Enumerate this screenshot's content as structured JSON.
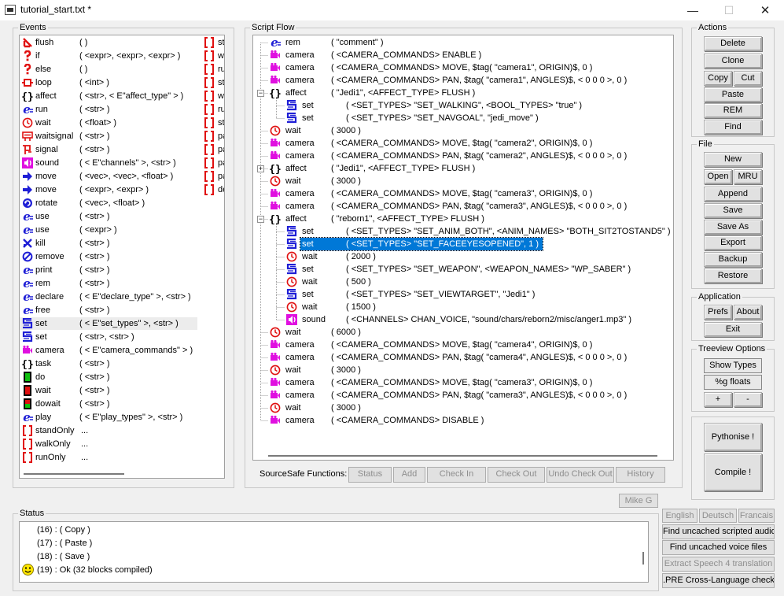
{
  "window": {
    "title": "tutorial_start.txt *",
    "minimize_glyph": "—",
    "maximize_glyph": "☐",
    "close_glyph": "✕"
  },
  "events": {
    "label": "Events",
    "items": [
      {
        "icon": "flush-icon",
        "name": "flush",
        "args": "(   )"
      },
      {
        "icon": "if-icon",
        "name": "if",
        "args": "( <expr>, <expr>, <expr> )"
      },
      {
        "icon": "else-icon",
        "name": "else",
        "args": "(   )"
      },
      {
        "icon": "loop-icon",
        "name": "loop",
        "args": "( <int> )"
      },
      {
        "icon": "affect-icon",
        "name": "affect",
        "args": "( <str>, < E\"affect_type\" > )"
      },
      {
        "icon": "run-icon",
        "name": "run",
        "args": "( <str> )"
      },
      {
        "icon": "wait-icon",
        "name": "wait",
        "args": "( <float> )"
      },
      {
        "icon": "waitsignal-icon",
        "name": "waitsignal",
        "args": "( <str> )"
      },
      {
        "icon": "signal-icon",
        "name": "signal",
        "args": "( <str> )"
      },
      {
        "icon": "sound-icon",
        "name": "sound",
        "args": "( < E\"channels\" >, <str> )"
      },
      {
        "icon": "move-icon",
        "name": "move",
        "args": "( <vec>, <vec>, <float> )"
      },
      {
        "icon": "move-icon",
        "name": "move",
        "args": "( <expr>, <expr> )"
      },
      {
        "icon": "rotate-icon",
        "name": "rotate",
        "args": "( <vec>, <float> )"
      },
      {
        "icon": "use-icon",
        "name": "use",
        "args": "( <str> )"
      },
      {
        "icon": "use-icon",
        "name": "use",
        "args": "( <expr> )"
      },
      {
        "icon": "kill-icon",
        "name": "kill",
        "args": "( <str> )"
      },
      {
        "icon": "remove-icon",
        "name": "remove",
        "args": "( <str> )"
      },
      {
        "icon": "print-icon",
        "name": "print",
        "args": "( <str> )"
      },
      {
        "icon": "rem-icon",
        "name": "rem",
        "args": "( <str> )"
      },
      {
        "icon": "declare-icon",
        "name": "declare",
        "args": "( < E\"declare_type\" >, <str> )"
      },
      {
        "icon": "free-icon",
        "name": "free",
        "args": "( <str> )"
      },
      {
        "icon": "set-icon",
        "name": "set",
        "args": "( < E\"set_types\" >, <str> )"
      },
      {
        "icon": "set-icon",
        "name": "set",
        "args": "( <str>, <str> )"
      },
      {
        "icon": "camera-icon",
        "name": "camera",
        "args": "( < E\"camera_commands\" > )"
      },
      {
        "icon": "task-icon",
        "name": "task",
        "args": "( <str> )"
      },
      {
        "icon": "do-icon",
        "name": "do",
        "args": "( <str> )"
      },
      {
        "icon": "wait-task-icon",
        "name": "wait",
        "args": "( <str> )"
      },
      {
        "icon": "dowait-icon",
        "name": "dowait",
        "args": "( <str> )"
      },
      {
        "icon": "play-icon",
        "name": "play",
        "args": "( < E\"play_types\" >, <str> )"
      },
      {
        "icon": "bracket-icon",
        "name": "standOnly",
        "args": "..."
      },
      {
        "icon": "bracket-icon",
        "name": "walkOnly",
        "args": "..."
      },
      {
        "icon": "bracket-icon",
        "name": "runOnly",
        "args": "..."
      }
    ],
    "col2": [
      "st",
      "w",
      "ru",
      "st",
      "w",
      "ru",
      "st",
      "pa",
      "pa",
      "pa",
      "pa",
      "de"
    ]
  },
  "script_flow": {
    "label": "Script Flow",
    "rows": [
      {
        "icon": "rem-icon",
        "name": "rem",
        "args": "( \"comment\" )"
      },
      {
        "icon": "camera-icon",
        "name": "camera",
        "args": "( <CAMERA_COMMANDS> ENABLE )"
      },
      {
        "icon": "camera-icon",
        "name": "camera",
        "args": "( <CAMERA_COMMANDS> MOVE, $tag( \"camera1\", ORIGIN)$, 0 )"
      },
      {
        "icon": "camera-icon",
        "name": "camera",
        "args": "( <CAMERA_COMMANDS> PAN, $tag( \"camera1\", ANGLES)$, < 0 0 0 >, 0 )"
      },
      {
        "icon": "affect-icon",
        "name": "affect",
        "args": "( \"Jedi1\", <AFFECT_TYPE> FLUSH )"
      },
      {
        "icon": "set-icon",
        "name": "set",
        "args": "( <SET_TYPES> \"SET_WALKING\", <BOOL_TYPES> \"true\" )"
      },
      {
        "icon": "set-icon",
        "name": "set",
        "args": "( <SET_TYPES> \"SET_NAVGOAL\", \"jedi_move\" )"
      },
      {
        "icon": "wait-icon",
        "name": "wait",
        "args": "( 3000 )"
      },
      {
        "icon": "camera-icon",
        "name": "camera",
        "args": "( <CAMERA_COMMANDS> MOVE, $tag( \"camera2\", ORIGIN)$, 0 )"
      },
      {
        "icon": "camera-icon",
        "name": "camera",
        "args": "( <CAMERA_COMMANDS> PAN, $tag( \"camera2\", ANGLES)$, < 0 0 0 >, 0 )"
      },
      {
        "icon": "affect-icon",
        "name": "affect",
        "args": "( \"Jedi1\", <AFFECT_TYPE> FLUSH )"
      },
      {
        "icon": "wait-icon",
        "name": "wait",
        "args": "( 3000 )"
      },
      {
        "icon": "camera-icon",
        "name": "camera",
        "args": "( <CAMERA_COMMANDS> MOVE, $tag( \"camera3\", ORIGIN)$, 0 )"
      },
      {
        "icon": "camera-icon",
        "name": "camera",
        "args": "( <CAMERA_COMMANDS> PAN, $tag( \"camera3\", ANGLES)$, < 0 0 0 >, 0 )"
      },
      {
        "icon": "affect-icon",
        "name": "affect",
        "args": "( \"reborn1\", <AFFECT_TYPE> FLUSH )"
      },
      {
        "icon": "set-icon",
        "name": "set",
        "args": "( <SET_TYPES> \"SET_ANIM_BOTH\", <ANIM_NAMES> \"BOTH_SIT2TOSTAND5\" )"
      },
      {
        "icon": "set-icon",
        "name": "set",
        "args": "( <SET_TYPES> \"SET_FACEEYESOPENED\", 1 )"
      },
      {
        "icon": "wait-icon",
        "name": "wait",
        "args": "( 2000 )"
      },
      {
        "icon": "set-icon",
        "name": "set",
        "args": "( <SET_TYPES> \"SET_WEAPON\", <WEAPON_NAMES> \"WP_SABER\" )"
      },
      {
        "icon": "wait-icon",
        "name": "wait",
        "args": "( 500 )"
      },
      {
        "icon": "set-icon",
        "name": "set",
        "args": "( <SET_TYPES> \"SET_VIEWTARGET\", \"Jedi1\" )"
      },
      {
        "icon": "wait-icon",
        "name": "wait",
        "args": "( 1500 )"
      },
      {
        "icon": "sound-icon",
        "name": "sound",
        "args": "( <CHANNELS> CHAN_VOICE, \"sound/chars/reborn2/misc/anger1.mp3\" )"
      },
      {
        "icon": "wait-icon",
        "name": "wait",
        "args": "( 6000 )"
      },
      {
        "icon": "camera-icon",
        "name": "camera",
        "args": "( <CAMERA_COMMANDS> MOVE, $tag( \"camera4\", ORIGIN)$, 0 )"
      },
      {
        "icon": "camera-icon",
        "name": "camera",
        "args": "( <CAMERA_COMMANDS> PAN, $tag( \"camera4\", ANGLES)$, < 0 0 0 >, 0 )"
      },
      {
        "icon": "wait-icon",
        "name": "wait",
        "args": "( 3000 )"
      },
      {
        "icon": "camera-icon",
        "name": "camera",
        "args": "( <CAMERA_COMMANDS> MOVE, $tag( \"camera3\", ORIGIN)$, 0 )"
      },
      {
        "icon": "camera-icon",
        "name": "camera",
        "args": "( <CAMERA_COMMANDS> PAN, $tag( \"camera3\", ANGLES)$, < 0 0 0 >, 0 )"
      },
      {
        "icon": "wait-icon",
        "name": "wait",
        "args": "( 3000 )"
      },
      {
        "icon": "camera-icon",
        "name": "camera",
        "args": "( <CAMERA_COMMANDS> DISABLE )"
      }
    ],
    "selected_row": 16,
    "sourcesafe": {
      "label": "SourceSafe Functions:",
      "status": "Status",
      "add": "Add",
      "check_in": "Check In",
      "check_out": "Check Out",
      "undo_check_out": "Undo Check Out",
      "history": "History"
    }
  },
  "actions": {
    "label": "Actions",
    "delete": "Delete",
    "clone": "Clone",
    "copy": "Copy",
    "cut": "Cut",
    "paste": "Paste",
    "rem": "REM",
    "find": "Find"
  },
  "file": {
    "label": "File",
    "new": "New",
    "open": "Open",
    "mru": "MRU",
    "append": "Append",
    "save": "Save",
    "save_as": "Save As",
    "export": "Export",
    "backup": "Backup",
    "restore": "Restore"
  },
  "application": {
    "label": "Application",
    "prefs": "Prefs",
    "about": "About",
    "exit": "Exit"
  },
  "treeview_options": {
    "label": "Treeview Options",
    "show_types": "Show Types",
    "g_floats": "%g floats",
    "plus": "+",
    "minus": "-"
  },
  "pythonise": "Pythonise !",
  "compile": "Compile !",
  "mike_g": "Mike G",
  "language": {
    "english": "English",
    "deutsch": "Deutsch",
    "francais": "Francais",
    "find_uncached_audio": "Find uncached scripted audio",
    "find_uncached_voice": "Find uncached voice files",
    "extract_speech": "Extract Speech 4 translation",
    "pre_check": ".PRE Cross-Language check"
  },
  "status": {
    "label": "Status",
    "lines": [
      "(16) : ( Copy )",
      "(17) : ( Paste )",
      "(18) : ( Save )",
      "(19) : Ok   (32 blocks compiled)"
    ]
  },
  "colors": {
    "selection": "#0078d7",
    "icon_blue": "#1f1fd6",
    "icon_red": "#e01010",
    "icon_magenta": "#e010e0",
    "icon_green": "#10c010"
  }
}
